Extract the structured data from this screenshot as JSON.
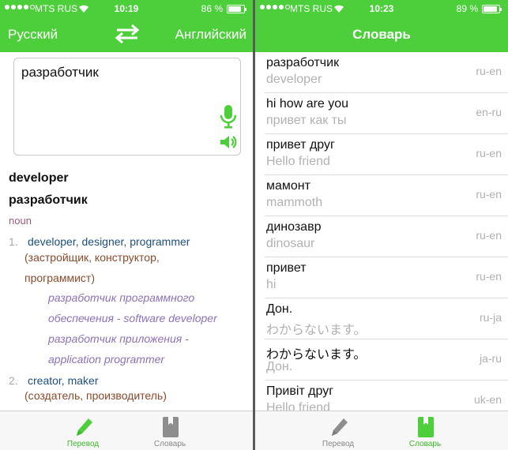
{
  "colors": {
    "accent": "#4ccf3a",
    "tab_active": "#3bb82a",
    "sense_main": "#1e4f7b",
    "sense_ru": "#8a4a2b",
    "example": "#8c72b7",
    "pos": "#a35a7a"
  },
  "left": {
    "status": {
      "carrier": "MTS RUS",
      "time": "10:19",
      "battery": "86 %",
      "battery_level": 0.86
    },
    "nav": {
      "source_lang": "Русский",
      "target_lang": "Английский",
      "swap_icon": "swap-arrows-icon"
    },
    "input": {
      "value": "разработчик",
      "mic_icon": "microphone-icon",
      "speaker_icon": "speaker-icon"
    },
    "result": {
      "headword": "developer",
      "source_word": "разработчик",
      "part_of_speech": "noun",
      "senses": [
        {
          "num": "1.",
          "translations": "developer, designer, programmer",
          "russian_line1": "(застройщик, конструктор,",
          "russian_line2": "программист)",
          "examples": [
            "разработчик программного",
            "обеспечения - software developer",
            "разработчик приложения -",
            "application programmer"
          ]
        },
        {
          "num": "2.",
          "translations": "creator, maker",
          "russian_line1": "(создатель, производитель)"
        }
      ]
    },
    "tabs": [
      {
        "label": "Перевод",
        "icon": "pencil-icon",
        "active": true
      },
      {
        "label": "Словарь",
        "icon": "book-icon",
        "active": false
      }
    ]
  },
  "right": {
    "status": {
      "carrier": "MTS RUS",
      "time": "10:23",
      "battery": "89 %",
      "battery_level": 0.89
    },
    "nav": {
      "title": "Словарь"
    },
    "entries": [
      {
        "source": "разработчик",
        "translation": "developer",
        "pair": "ru-en"
      },
      {
        "source": "hi how are you",
        "translation": "привет как ты",
        "pair": "en-ru"
      },
      {
        "source": "привет друг",
        "translation": "Hello friend",
        "pair": "ru-en"
      },
      {
        "source": "мамонт",
        "translation": "mammoth",
        "pair": "ru-en"
      },
      {
        "source": "динозавр",
        "translation": "dinosaur",
        "pair": "ru-en"
      },
      {
        "source": "привет",
        "translation": "hi",
        "pair": "ru-en"
      },
      {
        "source": "Дон.",
        "translation": "わからないます。",
        "pair": "ru-ja"
      },
      {
        "source": "わからないます。",
        "translation": "Дон.",
        "pair": "ja-ru"
      },
      {
        "source": "Привіт друг",
        "translation": "Hello friend",
        "pair": "uk-en"
      }
    ],
    "tabs": [
      {
        "label": "Перевод",
        "icon": "pencil-icon",
        "active": false
      },
      {
        "label": "Словарь",
        "icon": "book-icon",
        "active": true
      }
    ]
  }
}
